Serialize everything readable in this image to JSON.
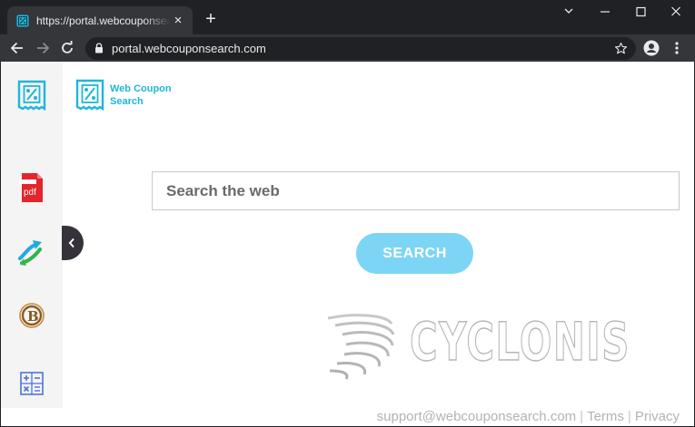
{
  "browser": {
    "tab_title": "https://portal.webcouponsearch.com",
    "tab_close": "×",
    "new_tab": "+",
    "url": "portal.webcouponsearch.com"
  },
  "sidebar": {
    "items": [
      {
        "name": "pdf",
        "label": "pdf"
      },
      {
        "name": "stock-chart"
      },
      {
        "name": "bitcoin",
        "label": "B"
      },
      {
        "name": "calculator"
      }
    ]
  },
  "logo": {
    "line1": "Web Coupon",
    "line2": "Search"
  },
  "search": {
    "placeholder": "Search the web",
    "button_label": "SEARCH"
  },
  "watermark": {
    "text": "CYCLONIS"
  },
  "footer": {
    "email": "support@webcouponsearch.com",
    "terms": "Terms",
    "privacy": "Privacy"
  },
  "colors": {
    "accent": "#1fb6d9",
    "button": "#7dd5f6",
    "chrome_dark": "#202124",
    "chrome_toolbar": "#35363a",
    "pdf_red": "#e3252c"
  }
}
